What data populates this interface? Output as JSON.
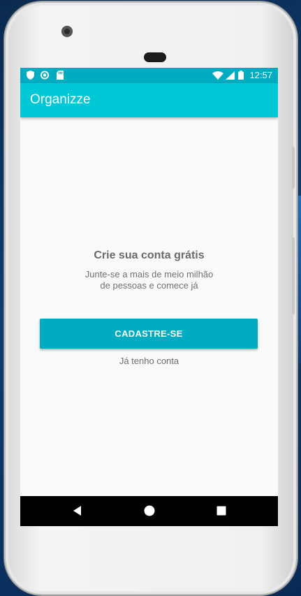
{
  "status_bar": {
    "time": "12:57",
    "left_icons": [
      "shield-icon",
      "sync-icon",
      "sd-card-icon"
    ],
    "right_icons": [
      "wifi-icon",
      "signal-icon",
      "battery-icon"
    ]
  },
  "app_bar": {
    "title": "Organizze",
    "color": "#00c8d6"
  },
  "main": {
    "title": "Crie sua conta grátis",
    "subtitle_line1": "Junte-se a mais de meio milhão",
    "subtitle_line2": "de pessoas e comece já",
    "signup_button_label": "CADASTRE-SE",
    "login_link_label": "Já tenho conta"
  },
  "nav_bar": {
    "buttons": [
      "back-icon",
      "home-icon",
      "recents-icon"
    ]
  },
  "colors": {
    "accent": "#00acc1",
    "status_bar": "#00acc1",
    "app_bar": "#00c8d6",
    "background": "#fafafa"
  }
}
